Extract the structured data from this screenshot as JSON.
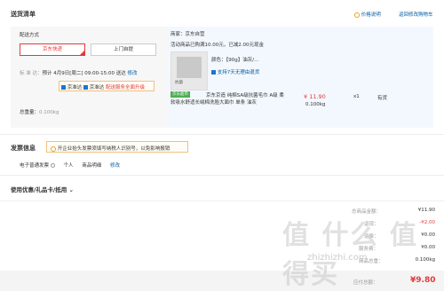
{
  "header": {
    "title": "送货清单",
    "price_notice": "价格说明",
    "back_link": "返回修改购物车"
  },
  "shipping": {
    "label": "配送方式",
    "options": [
      "京东快递",
      "上门自提"
    ],
    "date_prefix": "标 准 达：",
    "date_text": "预计 4月9日[周二] 09:00-15:00 送达",
    "date_edit": "修改",
    "service_tags": [
      "京准达",
      "京准达",
      "配送服务全面升级"
    ],
    "weight_label": "总重量：",
    "weight_value": "0.100kg"
  },
  "store": {
    "name": "商家：京东自营",
    "promo": "活动商品已购满10.00元，已减2.00元现金",
    "product": {
      "image_badge": "京东超市",
      "image_caption": "抗菌",
      "spec": "颜色：【90g】油灰/...",
      "service": "支持7天无理由退货",
      "title": "京东京造 纯棉SA级抗菌毛巾 A级 柔软吸水舒适长绒棉洗脸大面巾 单条 油灰",
      "price": "¥ 11.90",
      "weight": "0.100kg",
      "qty": "x1",
      "stock": "有货"
    }
  },
  "invoice": {
    "label": "发票信息",
    "notice": "开企业抬头发票须填写纳税人识别号，以免影响报销",
    "type": "电子普通发票",
    "holder": "个人",
    "content": "商品明细",
    "edit": "修改"
  },
  "coupon": {
    "label": "使用优惠/礼品卡/抵用"
  },
  "summary": {
    "rows": [
      {
        "label": "总商品金额：",
        "value": "¥11.90"
      },
      {
        "label": "返现：",
        "value": "-¥2.00"
      },
      {
        "label": "运费：",
        "value": "¥0.00"
      },
      {
        "label": "服务费：",
        "value": "¥0.00"
      },
      {
        "label": "商品总重：",
        "value": "0.100kg"
      }
    ],
    "total_label": "应付总额：",
    "total_value": "¥9.80"
  },
  "watermark": {
    "text": "值 什么 值得买",
    "domain": "zhizhizhi.com"
  },
  "colors": {
    "accent": "#e4393c",
    "link": "#005aa0",
    "panel": "#f3f8fe",
    "tag_green": "#4caf50"
  }
}
